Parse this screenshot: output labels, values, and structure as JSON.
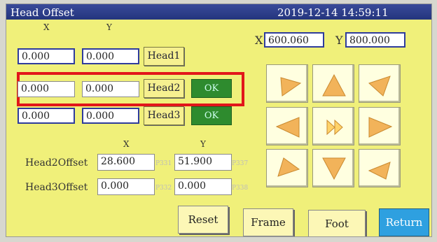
{
  "title": "Head Offset",
  "datetime": "2019-12-14 14:59:11",
  "col_x": "X",
  "col_y": "Y",
  "rows": [
    {
      "x": "0.000",
      "y": "0.000",
      "head": "Head1",
      "ok": ""
    },
    {
      "x": "0.000",
      "y": "0.000",
      "head": "Head2",
      "ok": "OK"
    },
    {
      "x": "0.000",
      "y": "0.000",
      "head": "Head3",
      "ok": "OK"
    }
  ],
  "pos": {
    "x_label": "X",
    "x_value": "600.060",
    "y_label": "Y",
    "y_value": "800.000"
  },
  "offset_header": {
    "x": "X",
    "y": "Y"
  },
  "offsets": [
    {
      "label": "Head2Offset",
      "x": "28.600",
      "px": "P331",
      "y": "51.900",
      "py": "P337"
    },
    {
      "label": "Head3Offset",
      "x": "0.000",
      "px": "P332",
      "y": "0.000",
      "py": "P338"
    }
  ],
  "buttons": {
    "reset": "Reset",
    "frame": "Frame",
    "foot": "Foot",
    "return": "Return"
  },
  "colors": {
    "screen": "#f0f07a",
    "titlebar": "#24357d",
    "arrow": "#f2b35a",
    "ok": "#2e8b2e",
    "return": "#2ea0e0"
  },
  "arrow_icons": [
    "up-left-arrow-icon",
    "up-arrow-icon",
    "up-right-arrow-icon",
    "left-arrow-icon",
    "fast-forward-icon",
    "right-arrow-icon",
    "down-left-arrow-icon",
    "down-arrow-icon",
    "down-right-arrow-icon"
  ]
}
